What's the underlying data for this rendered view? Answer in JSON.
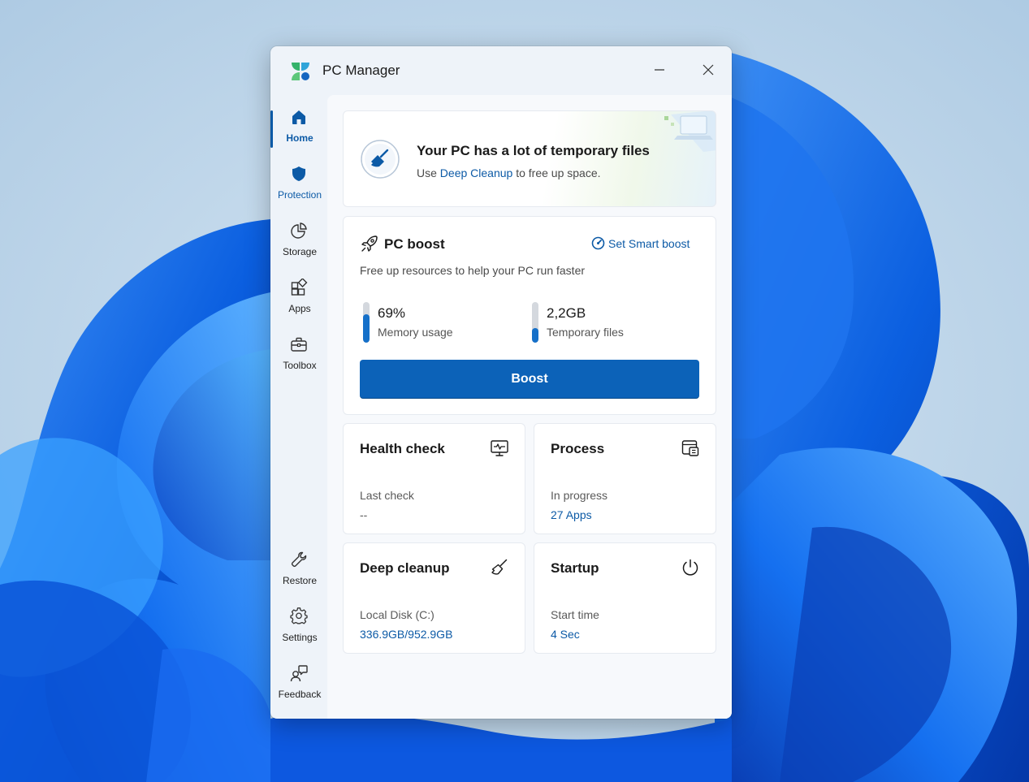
{
  "window": {
    "title": "PC Manager",
    "minimize_icon": "minimize-icon",
    "close_icon": "close-icon"
  },
  "sidebar": {
    "items": [
      {
        "label": "Home",
        "icon": "home-icon",
        "active": true
      },
      {
        "label": "Protection",
        "icon": "shield-icon"
      },
      {
        "label": "Storage",
        "icon": "pie-chart-icon"
      },
      {
        "label": "Apps",
        "icon": "apps-icon"
      },
      {
        "label": "Toolbox",
        "icon": "toolbox-icon"
      }
    ],
    "bottom_items": [
      {
        "label": "Restore",
        "icon": "wrench-icon"
      },
      {
        "label": "Settings",
        "icon": "gear-icon"
      },
      {
        "label": "Feedback",
        "icon": "feedback-icon"
      }
    ]
  },
  "banner": {
    "title": "Your PC has a lot of temporary files",
    "subtitle_prefix": "Use ",
    "subtitle_link": "Deep Cleanup",
    "subtitle_suffix": " to free up space.",
    "icon": "broom-icon"
  },
  "boost": {
    "title": "PC boost",
    "icon": "rocket-icon",
    "smart_boost_label": "Set Smart boost",
    "description": "Free up resources to help your PC run faster",
    "memory_value": "69%",
    "memory_label": "Memory usage",
    "memory_fraction": 0.69,
    "temp_value": "2,2GB",
    "temp_label": "Temporary files",
    "temp_fraction": 0.35,
    "button_label": "Boost",
    "accent": "#0c62b8"
  },
  "tiles": {
    "health": {
      "title": "Health check",
      "label": "Last check",
      "value": "--",
      "icon": "monitor-pulse-icon"
    },
    "process": {
      "title": "Process",
      "label": "In progress",
      "value": "27 Apps",
      "icon": "process-icon"
    },
    "cleanup": {
      "title": "Deep cleanup",
      "label": "Local Disk (C:)",
      "value": "336.9GB/952.9GB",
      "icon": "broom-icon"
    },
    "startup": {
      "title": "Startup",
      "label": "Start time",
      "value": "4 Sec",
      "icon": "power-icon"
    }
  }
}
